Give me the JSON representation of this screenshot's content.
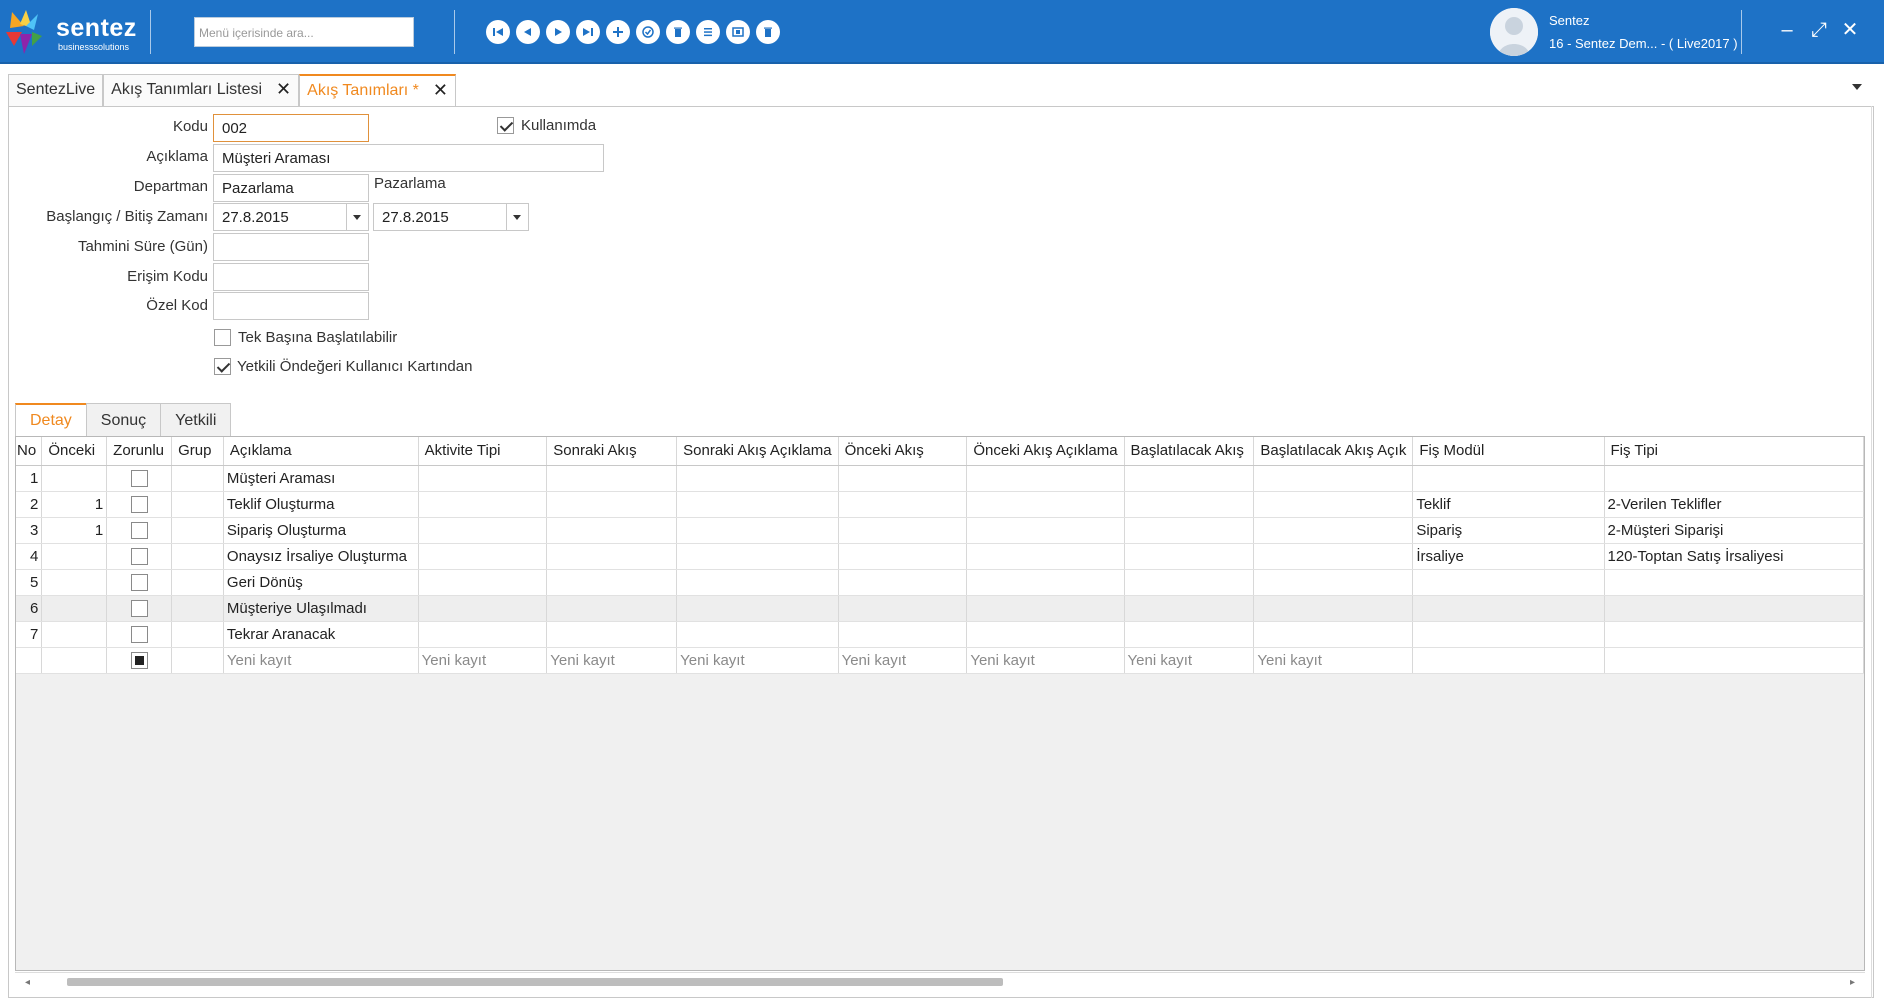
{
  "app": {
    "logo_text": "sentez",
    "logo_sub": "businesssolutions",
    "search_placeholder": "Menü içerisinde ara...",
    "user_name": "Sentez",
    "user_company": "16 - Sentez Dem... - ( Live2017 )",
    "nav_buttons": [
      "first-icon",
      "previous-icon",
      "next-icon",
      "last-icon",
      "add-icon",
      "approve-icon",
      "delete-icon",
      "list-icon",
      "copy-icon",
      "trash-icon"
    ],
    "window_controls": {
      "minimize": "–",
      "maximize": "⤢",
      "close": "✕"
    },
    "accent_color": "#1e72c6",
    "active_tab_color": "#f0891f"
  },
  "doc_tabs": [
    {
      "label": "SentezLive",
      "closable": false
    },
    {
      "label": "Akış Tanımları Listesi",
      "closable": true
    },
    {
      "label": "Akış Tanımları *",
      "closable": true,
      "active": true
    }
  ],
  "close_glyph": "✕",
  "form": {
    "kodu_label": "Kodu",
    "kodu_value": "002",
    "kullanimda_label": "Kullanımda",
    "kullanimda_checked": true,
    "aciklama_label": "Açıklama",
    "aciklama_value": "Müşteri Araması",
    "departman_label": "Departman",
    "departman_value": "Pazarlama",
    "departman_desc": "Pazarlama",
    "baslangic_label": "Başlangıç / Bitiş Zamanı",
    "baslangic_value": "27.8.2015",
    "bitis_value": "27.8.2015",
    "sure_label": "Tahmini Süre (Gün)",
    "sure_value": "",
    "erisim_label": "Erişim Kodu",
    "erisim_value": "",
    "ozel_label": "Özel Kod",
    "ozel_value": "",
    "tek_basina_label": "Tek Başına Başlatılabilir",
    "tek_basina_checked": false,
    "yetkili_label": "Yetkili Öndeğeri Kullanıcı Kartından",
    "yetkili_checked": true
  },
  "inner_tabs": [
    "Detay",
    "Sonuç",
    "Yetkili"
  ],
  "grid": {
    "columns": [
      "No",
      "Önceki",
      "Zorunlu",
      "Grup",
      "Açıklama",
      "Aktivite Tipi",
      "Sonraki Akış",
      "Sonraki Akış Açıklama",
      "Önceki Akış",
      "Önceki Akış Açıklama",
      "Başlatılacak Akış",
      "Başlatılacak Akış Açık",
      "Fiş Modül",
      "Fiş Tipi"
    ],
    "rows": [
      {
        "no": "1",
        "onceki": "",
        "aciklama": "Müşteri Araması",
        "fis_modul": "",
        "fis_tipi": ""
      },
      {
        "no": "2",
        "onceki": "1",
        "aciklama": "Teklif Oluşturma",
        "fis_modul": "Teklif",
        "fis_tipi": "2-Verilen Teklifler"
      },
      {
        "no": "3",
        "onceki": "1",
        "aciklama": "Sipariş Oluşturma",
        "fis_modul": "Sipariş",
        "fis_tipi": "2-Müşteri Siparişi"
      },
      {
        "no": "4",
        "onceki": "",
        "aciklama": "Onaysız İrsaliye Oluşturma",
        "fis_modul": "İrsaliye",
        "fis_tipi": "120-Toptan Satış İrsaliyesi"
      },
      {
        "no": "5",
        "onceki": "",
        "aciklama": "Geri Dönüş",
        "fis_modul": "",
        "fis_tipi": ""
      },
      {
        "no": "6",
        "onceki": "",
        "aciklama": "Müşteriye Ulaşılmadı",
        "fis_modul": "",
        "fis_tipi": ""
      },
      {
        "no": "7",
        "onceki": "",
        "aciklama": "Tekrar Aranacak",
        "fis_modul": "",
        "fis_tipi": ""
      }
    ],
    "new_row_placeholder": "Yeni kayıt"
  }
}
